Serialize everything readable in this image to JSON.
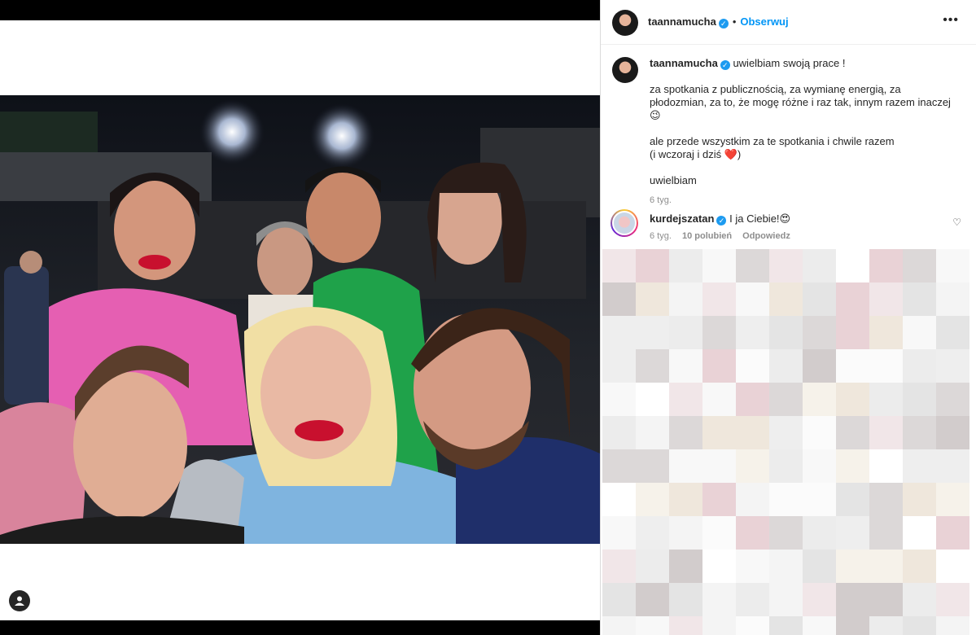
{
  "post": {
    "author": "taannamucha",
    "follow_label": "Obserwuj",
    "dot": "•",
    "more_label": "•••",
    "caption_line1": "uwielbiam swoją prace !",
    "caption_line2": "za spotkania z publicznością, za wymianę energią, za płodozmian, za to, że mogę różne i raz tak, innym razem inaczej 😉",
    "caption_line3a": "ale przede wszystkim za te spotkania i chwile razem",
    "caption_line3b": "(i wczoraj i dziś ❤️)",
    "caption_line4": "uwielbiam",
    "time": "6 tyg."
  },
  "comment": {
    "author": "kurdejszatan",
    "text": "I ja Ciebie!😍",
    "time": "6 tyg.",
    "likes": "10 polubień",
    "reply_label": "Odpowiedz"
  },
  "icons": {
    "verified": "verified-badge-icon",
    "heart": "heart-icon",
    "more": "more-options-icon",
    "user_tag": "user-tag-icon"
  },
  "colors": {
    "link": "#0095f6",
    "verified": "#1d9bf0",
    "muted": "#8e8e8e",
    "text": "#262626"
  }
}
